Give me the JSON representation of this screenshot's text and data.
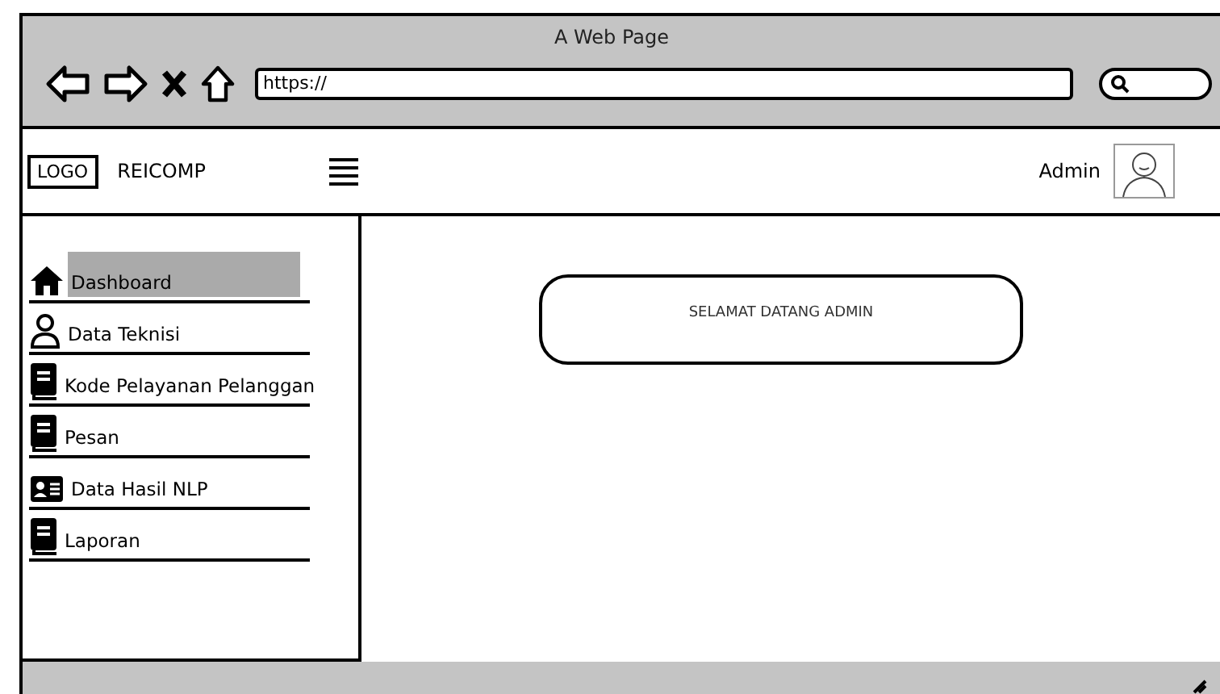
{
  "window": {
    "title": "A Web Page"
  },
  "browser": {
    "url": "https://"
  },
  "header": {
    "logo": "LOGO",
    "brand": "REICOMP",
    "user": "Admin"
  },
  "sidebar": {
    "items": [
      {
        "label": "Dashboard",
        "selected": true
      },
      {
        "label": "Data Teknisi",
        "selected": false
      },
      {
        "label": "Kode Pelayanan Pelanggan",
        "selected": false
      },
      {
        "label": "Pesan",
        "selected": false
      },
      {
        "label": "Data Hasil NLP",
        "selected": false
      },
      {
        "label": "Laporan",
        "selected": false
      }
    ]
  },
  "main": {
    "welcome": "SELAMAT DATANG ADMIN"
  }
}
